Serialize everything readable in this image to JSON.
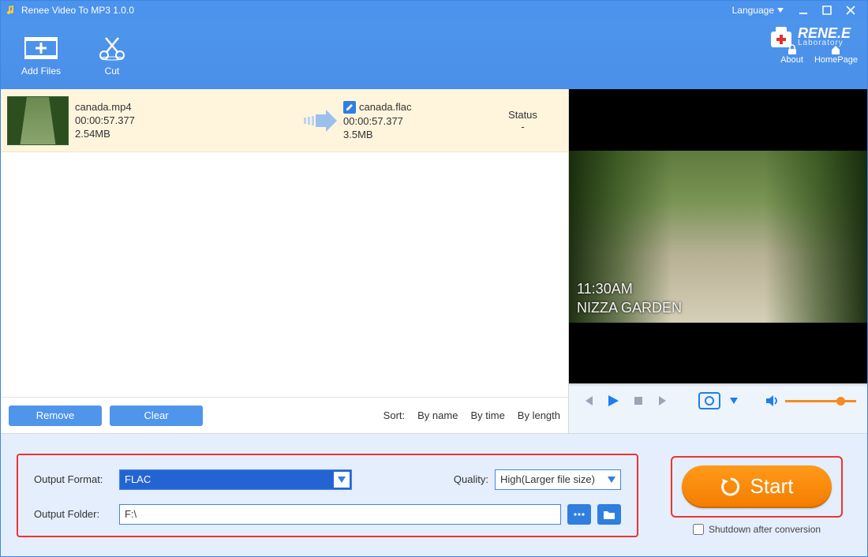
{
  "titlebar": {
    "title": "Renee Video To MP3 1.0.0",
    "language": "Language"
  },
  "toolbar": {
    "addfiles": "Add Files",
    "cut": "Cut"
  },
  "header": {
    "about": "About",
    "homepage": "HomePage",
    "logo_main": "RENE.E",
    "logo_sub": "Laboratory"
  },
  "file": {
    "src_name": "canada.mp4",
    "src_dur": "00:00:57.377",
    "src_size": "2.54MB",
    "dst_name": "canada.flac",
    "dst_dur": "00:00:57.377",
    "dst_size": "3.5MB",
    "status_h": "Status",
    "status_v": "-"
  },
  "leftbar": {
    "remove": "Remove",
    "clear": "Clear",
    "sortlabel": "Sort:",
    "byname": "By name",
    "bytime": "By time",
    "bylength": "By length"
  },
  "preview": {
    "overlay_time": "11:30AM",
    "overlay_place": "NIZZA GARDEN"
  },
  "output": {
    "format_label": "Output Format:",
    "format_value": "FLAC",
    "quality_label": "Quality:",
    "quality_value": "High(Larger file size)",
    "folder_label": "Output Folder:",
    "folder_value": "F:\\"
  },
  "start": {
    "button": "Start",
    "shutdown": "Shutdown after conversion"
  }
}
